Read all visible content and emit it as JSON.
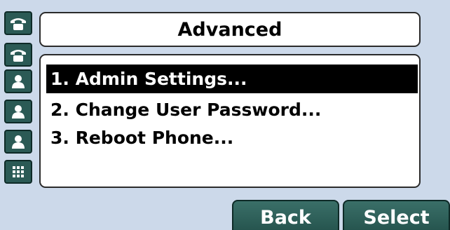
{
  "title": "Advanced",
  "menu": {
    "items": [
      {
        "label": "1. Admin Settings...",
        "selected": true
      },
      {
        "label": "2. Change User Password...",
        "selected": false
      },
      {
        "label": "3. Reboot Phone...",
        "selected": false
      }
    ]
  },
  "softkeys": {
    "back": "Back",
    "select": "Select"
  },
  "line_keys": [
    {
      "icon": "phone-handset-icon"
    },
    {
      "icon": "phone-handset-icon"
    },
    {
      "icon": "contact-person-icon"
    },
    {
      "icon": "contact-person-icon"
    },
    {
      "icon": "contact-person-icon"
    },
    {
      "icon": "dialpad-icon"
    }
  ],
  "colors": {
    "screen_background": "#ccd9ea",
    "key_green": "#2b5a55",
    "selection": "#000000"
  }
}
